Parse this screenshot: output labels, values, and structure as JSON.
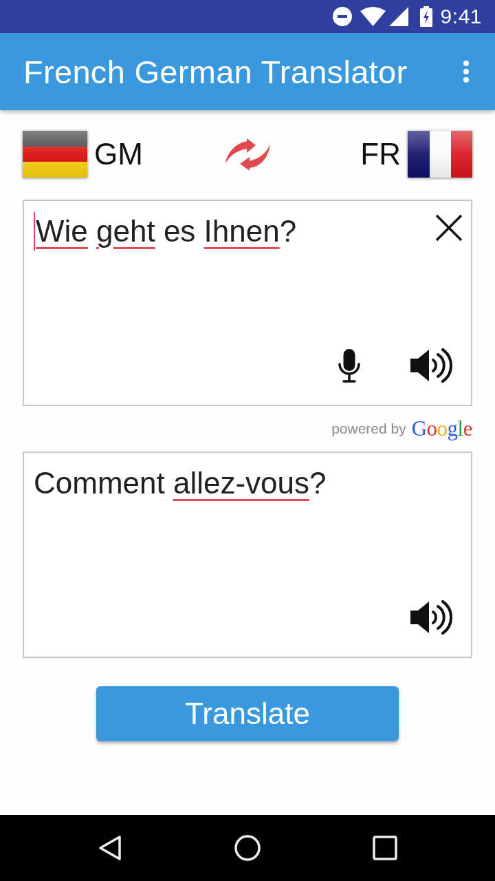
{
  "status_bar": {
    "time": "9:41"
  },
  "app_bar": {
    "title": "French German Translator"
  },
  "languages": {
    "source": {
      "code": "GM",
      "kind": "germany"
    },
    "target": {
      "code": "FR",
      "kind": "france"
    }
  },
  "source": {
    "focused": true,
    "segments": [
      {
        "text": "Wie geht",
        "flagged": true
      },
      {
        "text": " es ",
        "flagged": false
      },
      {
        "text": "Ihnen",
        "flagged": true
      },
      {
        "text": "?",
        "flagged": false
      }
    ]
  },
  "attribution": {
    "label": "powered by",
    "logo": "Google"
  },
  "translation": {
    "focused": false,
    "segments": [
      {
        "text": "Comment ",
        "flagged": false
      },
      {
        "text": "allez-vous",
        "flagged": true
      },
      {
        "text": "?",
        "flagged": false
      }
    ]
  },
  "translate_button": {
    "label": "Translate"
  }
}
